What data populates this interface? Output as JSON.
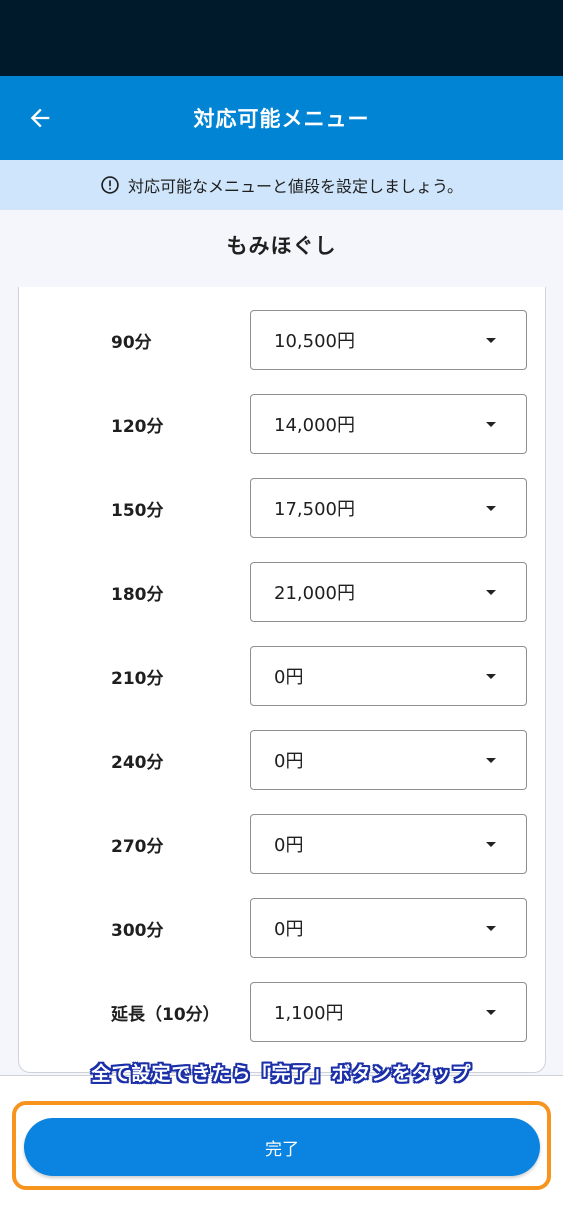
{
  "app_bar": {
    "title": "対応可能メニュー",
    "back_icon": "arrow-left-icon"
  },
  "info_banner": {
    "icon": "info-circle-icon",
    "text": "対応可能なメニューと値段を設定しましょう。"
  },
  "section": {
    "title": "もみほぐし"
  },
  "menu_rows": [
    {
      "label": "90分",
      "price": "10,500円"
    },
    {
      "label": "120分",
      "price": "14,000円"
    },
    {
      "label": "150分",
      "price": "17,500円"
    },
    {
      "label": "180分",
      "price": "21,000円"
    },
    {
      "label": "210分",
      "price": "0円"
    },
    {
      "label": "240分",
      "price": "0円"
    },
    {
      "label": "270分",
      "price": "0円"
    },
    {
      "label": "300分",
      "price": "0円"
    },
    {
      "label": "延長（10分）",
      "price": "1,100円"
    }
  ],
  "annotation": {
    "hint": "全て設定できたら「完了」ボタンをタップ",
    "frame_color": "#f7941d"
  },
  "footer": {
    "done_label": "完了"
  },
  "colors": {
    "app_bar": "#0284d4",
    "status_bar": "#001a2c",
    "banner": "#cfe5fb",
    "button": "#0a84e0"
  }
}
